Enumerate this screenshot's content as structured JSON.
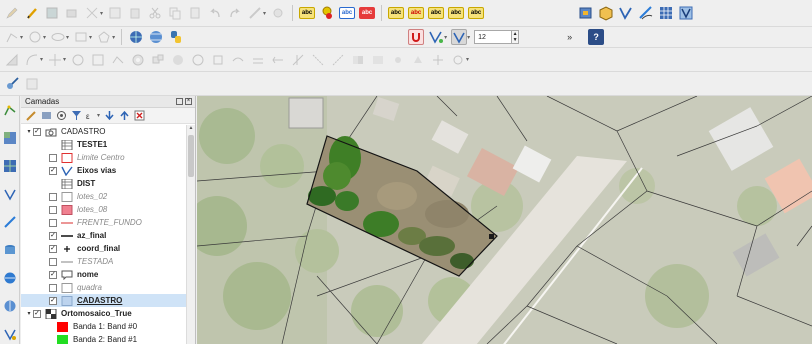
{
  "layers_panel": {
    "title": "Camadas",
    "layers": [
      {
        "label": "CADASTRO",
        "style": "normal",
        "checked": true,
        "indent": 1,
        "twisty": "▾",
        "sym": "group",
        "selected": false
      },
      {
        "label": "TESTE1",
        "style": "bold",
        "checked": null,
        "indent": 2,
        "twisty": "",
        "sym": "table",
        "selected": false
      },
      {
        "label": "Limite Centro",
        "style": "ital",
        "checked": false,
        "indent": 2,
        "twisty": "",
        "sym": "poly-red-outline",
        "selected": false
      },
      {
        "label": "Eixos vias",
        "style": "bold",
        "checked": true,
        "indent": 2,
        "twisty": "",
        "sym": "line-blue",
        "selected": false
      },
      {
        "label": "DIST",
        "style": "bold",
        "checked": null,
        "indent": 2,
        "twisty": "",
        "sym": "table",
        "selected": false
      },
      {
        "label": "lotes_02",
        "style": "ital",
        "checked": false,
        "indent": 2,
        "twisty": "",
        "sym": "poly-white",
        "selected": false
      },
      {
        "label": "lotes_08",
        "style": "ital",
        "checked": false,
        "indent": 2,
        "twisty": "",
        "sym": "poly-pink",
        "selected": false
      },
      {
        "label": "FRENTE_FUNDO",
        "style": "ital",
        "checked": false,
        "indent": 2,
        "twisty": "",
        "sym": "line-red",
        "selected": false
      },
      {
        "label": "az_final",
        "style": "bold",
        "checked": true,
        "indent": 2,
        "twisty": "",
        "sym": "line-black",
        "selected": false
      },
      {
        "label": "coord_final",
        "style": "bold",
        "checked": true,
        "indent": 2,
        "twisty": "",
        "sym": "point-cross",
        "selected": false
      },
      {
        "label": "TESTADA",
        "style": "ital",
        "checked": false,
        "indent": 2,
        "twisty": "",
        "sym": "line-gray",
        "selected": false
      },
      {
        "label": "nome",
        "style": "bold",
        "checked": true,
        "indent": 2,
        "twisty": "",
        "sym": "label",
        "selected": false
      },
      {
        "label": "quadra",
        "style": "ital",
        "checked": false,
        "indent": 2,
        "twisty": "",
        "sym": "poly-white",
        "selected": false
      },
      {
        "label": "CADASTRO",
        "style": "bold-ul",
        "checked": true,
        "indent": 2,
        "twisty": "",
        "sym": "poly-blue",
        "selected": true
      },
      {
        "label": "Ortomosaico_True",
        "style": "bold",
        "checked": true,
        "indent": 1,
        "twisty": "▾",
        "sym": "raster",
        "selected": false
      },
      {
        "label": "Banda 1: Band #0",
        "style": "normal",
        "checked": null,
        "indent": 3,
        "twisty": "",
        "sym": "swatch-red",
        "selected": false
      },
      {
        "label": "Banda 2: Band #1",
        "style": "normal",
        "checked": null,
        "indent": 3,
        "twisty": "",
        "sym": "swatch-green",
        "selected": false
      }
    ]
  },
  "snapping": {
    "tolerance_value": "12"
  },
  "colors": {
    "selected_row": "#cfe3f7",
    "cadastro_fill": "#bcd3ee",
    "swatch_red": "#ff0000",
    "swatch_green": "#22dd22",
    "lotes_08_fill": "#f08090"
  }
}
